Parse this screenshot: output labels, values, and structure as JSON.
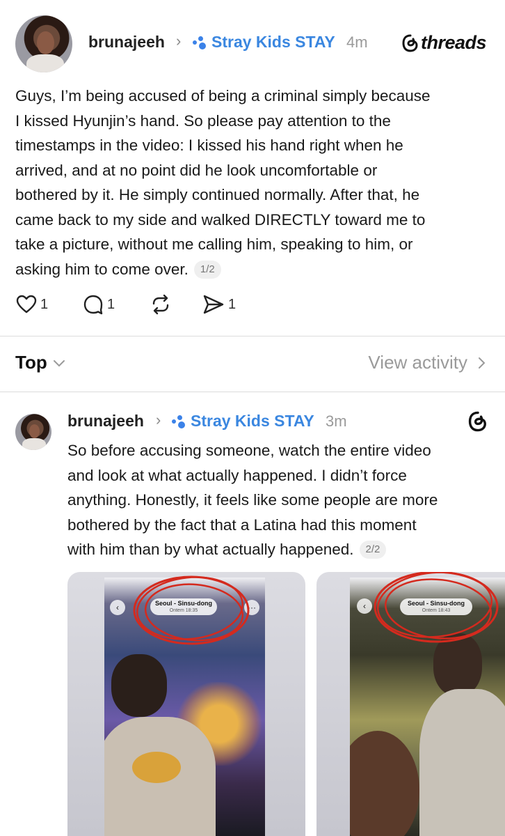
{
  "post1": {
    "username": "brunajeeh",
    "community": "Stray Kids STAY",
    "time": "4m",
    "brand": "threads",
    "lines": [
      "Guys, I’m being accused of being a criminal simply because",
      "I kissed Hyunjin’s hand. So please pay attention to the",
      "timestamps in the video: I kissed his hand right when he",
      "arrived, and at no point did he look uncomfortable or",
      "bothered by it. He simply continued normally. After that, he",
      "came back to my side and walked DIRECTLY toward me to",
      "take a picture, without me calling him, speaking to him, or",
      "asking him to come over."
    ],
    "page_badge": "1/2",
    "likes": "1",
    "replies": "1",
    "shares": "1"
  },
  "sort": {
    "label": "Top",
    "view_activity": "View activity"
  },
  "post2": {
    "username": "brunajeeh",
    "community": "Stray Kids STAY",
    "time": "3m",
    "lines": [
      "So before accusing someone, watch the entire video",
      "and look at what actually happened. I didn’t force",
      "anything. Honestly, it feels like some people are more",
      "bothered by the fact that a Latina had this moment",
      "with him than by what actually happened."
    ],
    "page_badge": "2/2",
    "media": [
      {
        "location": "Seoul - Sinsu-dong",
        "when": "Ontem 18:35"
      },
      {
        "location": "Seoul - Sinsu-dong",
        "when": "Ontem 18:43"
      }
    ]
  },
  "icons": [
    "heart-icon",
    "comment-icon",
    "repost-icon",
    "share-icon",
    "chevron-right-icon",
    "chevron-down-icon",
    "threads-logo-icon",
    "community-icon"
  ],
  "colors": {
    "community_blue": "#3b87e0",
    "annotation_red": "#d42a1e",
    "divider": "#dcdcdc"
  }
}
